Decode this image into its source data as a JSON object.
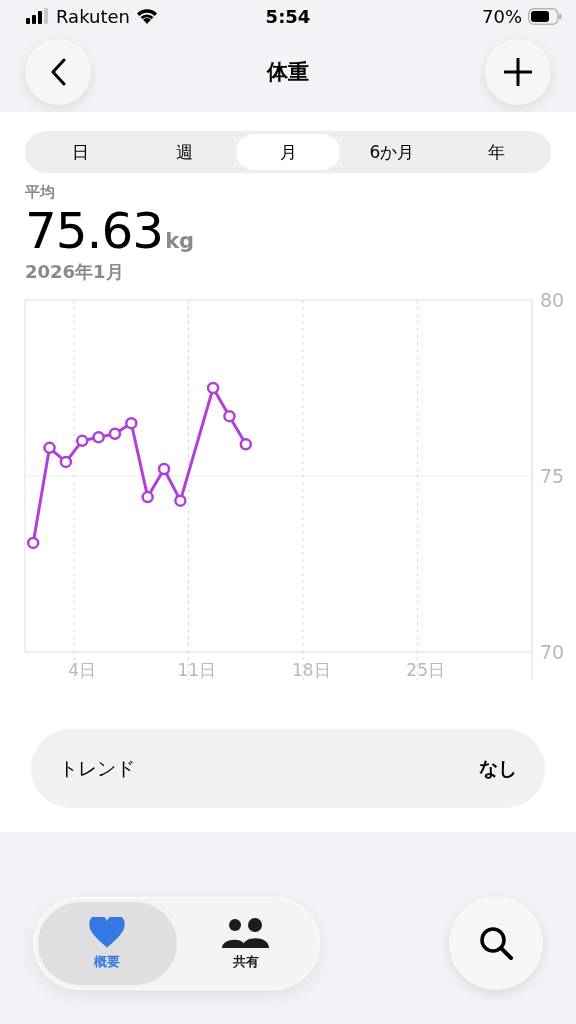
{
  "status_bar": {
    "carrier": "Rakuten",
    "time": "5:54",
    "battery": "70%"
  },
  "header": {
    "title": "体重"
  },
  "periods": [
    {
      "label": "日",
      "selected": false
    },
    {
      "label": "週",
      "selected": false
    },
    {
      "label": "月",
      "selected": true
    },
    {
      "label": "6か月",
      "selected": false
    },
    {
      "label": "年",
      "selected": false
    }
  ],
  "summary": {
    "label": "平均",
    "value": "75.63",
    "unit": "kg",
    "date": "2026年1月"
  },
  "chart_data": {
    "type": "line",
    "x": [
      1,
      2,
      3,
      4,
      5,
      6,
      7,
      8,
      9,
      10,
      12,
      13,
      14
    ],
    "series": [
      {
        "color": "#b040d8",
        "marker": "circle",
        "values": [
          73.1,
          75.8,
          75.4,
          76.0,
          76.1,
          76.2,
          76.5,
          74.4,
          75.2,
          74.3,
          77.5,
          76.7,
          75.9
        ]
      }
    ],
    "xlim": [
      0.5,
      31.5
    ],
    "ylim": [
      70,
      80
    ],
    "xticks": [
      {
        "value": 4,
        "label": "4日"
      },
      {
        "value": 11,
        "label": "11日"
      },
      {
        "value": 18,
        "label": "18日"
      },
      {
        "value": 25,
        "label": "25日"
      }
    ],
    "yticks": [
      70,
      75,
      80
    ]
  },
  "trend": {
    "label": "トレンド",
    "value": "なし"
  },
  "bottom_tabs": [
    {
      "label": "概要",
      "kind": "heart",
      "selected": true
    },
    {
      "label": "共有",
      "kind": "people",
      "selected": false
    }
  ]
}
